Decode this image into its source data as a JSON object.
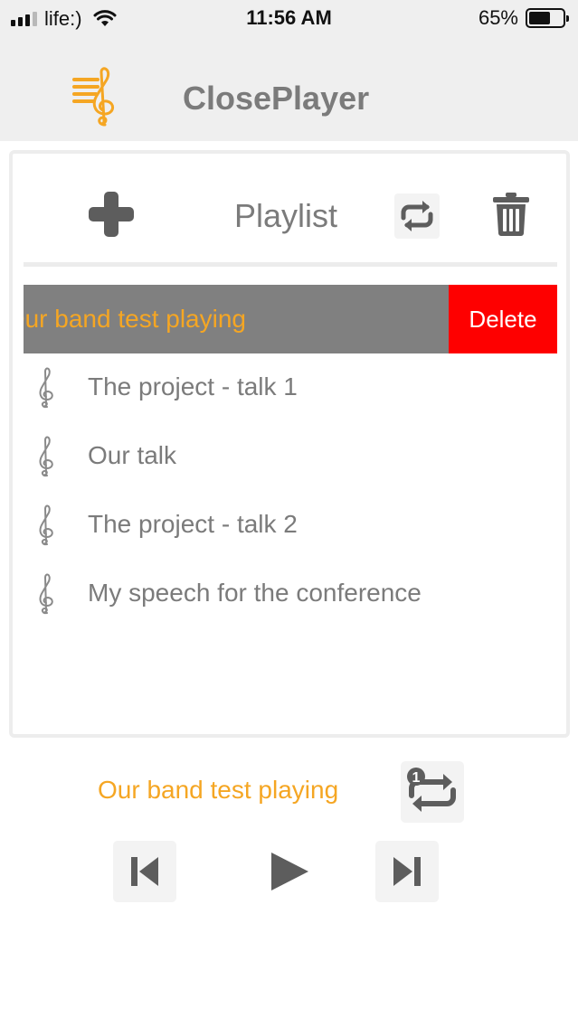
{
  "status_bar": {
    "carrier": "life:)",
    "time": "11:56 AM",
    "battery_percent": "65%",
    "battery_level": 0.65,
    "signal_bars": 3
  },
  "header": {
    "app_title": "ClosePlayer",
    "logo_icon": "music-clef-logo-icon"
  },
  "playlist": {
    "title": "Playlist",
    "add_icon": "plus-icon",
    "repeat_icon": "repeat-icon",
    "trash_icon": "trash-icon",
    "swiped_item": {
      "title": "Our band test playing",
      "delete_label": "Delete"
    },
    "items": [
      {
        "title": "The project - talk 1"
      },
      {
        "title": "Our talk"
      },
      {
        "title": "The project - talk 2"
      },
      {
        "title": "My speech for the conference"
      }
    ]
  },
  "player": {
    "now_playing": "Our band test playing",
    "repeat_one_icon": "repeat-one-icon",
    "prev_icon": "skip-previous-icon",
    "play_icon": "play-icon",
    "next_icon": "skip-next-icon"
  },
  "colors": {
    "accent": "#f5a623",
    "text_gray": "#7b7b7b",
    "delete_red": "#fe0000",
    "swipe_gray": "#808080"
  }
}
